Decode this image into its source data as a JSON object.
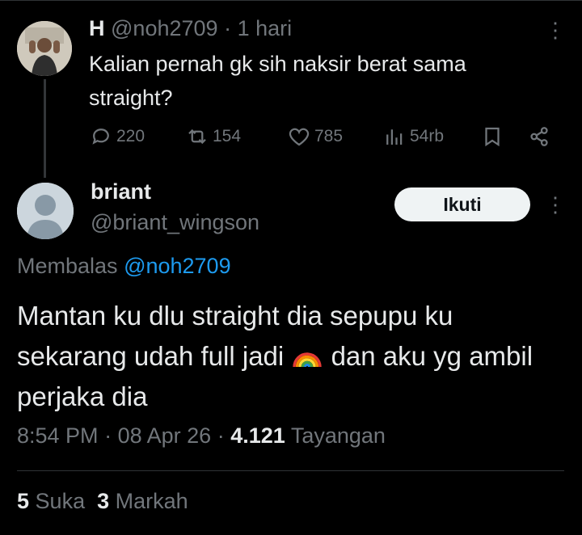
{
  "parent": {
    "display_name": "H",
    "handle": "@noh2709",
    "separator": "·",
    "time": "1 hari",
    "text": "Kalian pernah gk sih naksir berat sama straight?",
    "actions": {
      "reply_count": "220",
      "repost_count": "154",
      "like_count": "785",
      "view_count": "54rb"
    },
    "icons": [
      "reply-icon",
      "repost-icon",
      "like-icon",
      "views-icon",
      "bookmark-icon",
      "share-icon"
    ]
  },
  "reply": {
    "display_name": "briant",
    "handle": "@briant_wingson",
    "follow_label": "Ikuti",
    "replying_prefix": "Membalas",
    "replying_to": "@noh2709",
    "text_before_emoji": "Mantan ku dlu straight dia sepupu ku sekarang udah full jadi ",
    "emoji": "rainbow-emoji",
    "text_after_emoji": " dan aku yg ambil perjaka dia",
    "time": "8:54 PM",
    "date": "08 Apr 26",
    "views": "4.121",
    "views_label": "Tayangan",
    "sep": "·",
    "likes": "5",
    "likes_label": "Suka",
    "bookmarks": "3",
    "bookmarks_label": "Markah"
  },
  "colors": {
    "background": "#000000",
    "text": "#e7e9ea",
    "muted": "#71767b",
    "link": "#1d9bf0",
    "divider": "#2f3336"
  }
}
